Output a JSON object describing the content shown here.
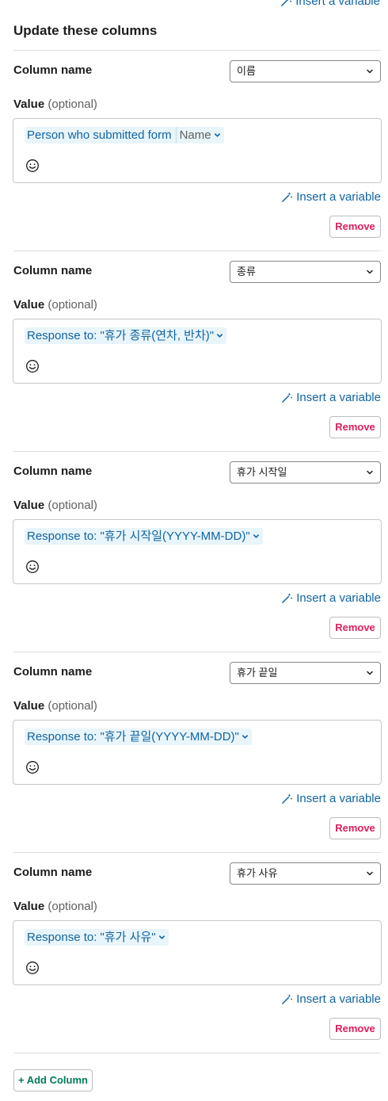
{
  "header": {
    "insert_variable_label": "Insert a variable",
    "section_title": "Update these columns"
  },
  "columns": [
    {
      "column_name_label": "Column name",
      "selected": "이름",
      "value_label": "Value",
      "optional_label": "(optional)",
      "token_text": "Person who submitted form",
      "token_sub": "Name",
      "insert_variable_label": "Insert a variable",
      "remove_label": "Remove"
    },
    {
      "column_name_label": "Column name",
      "selected": "종류",
      "value_label": "Value",
      "optional_label": "(optional)",
      "token_text": "Response to: \"휴가 종류(연차, 반차)\"",
      "token_sub": "",
      "insert_variable_label": "Insert a variable",
      "remove_label": "Remove"
    },
    {
      "column_name_label": "Column name",
      "selected": "휴가 시작일",
      "value_label": "Value",
      "optional_label": "(optional)",
      "token_text": "Response to: \"휴가 시작일(YYYY-MM-DD)\"",
      "token_sub": "",
      "insert_variable_label": "Insert a variable",
      "remove_label": "Remove"
    },
    {
      "column_name_label": "Column name",
      "selected": "휴가 끝일",
      "value_label": "Value",
      "optional_label": "(optional)",
      "token_text": "Response to: \"휴가 끝일(YYYY-MM-DD)\"",
      "token_sub": "",
      "insert_variable_label": "Insert a variable",
      "remove_label": "Remove"
    },
    {
      "column_name_label": "Column name",
      "selected": "휴가 사유",
      "value_label": "Value",
      "optional_label": "(optional)",
      "token_text": "Response to: \"휴가 사유\"",
      "token_sub": "",
      "insert_variable_label": "Insert a variable",
      "remove_label": "Remove"
    }
  ],
  "footer": {
    "add_column_label": "+ Add Column"
  },
  "icons": {
    "insert": "magic-wand-icon",
    "emoji": "smiley-icon",
    "chevron": "chevron-down-icon"
  },
  "colors": {
    "link": "#1264a3",
    "danger": "#e01e5a",
    "primary": "#007a5a",
    "token_bg": "#e8f5fa"
  }
}
